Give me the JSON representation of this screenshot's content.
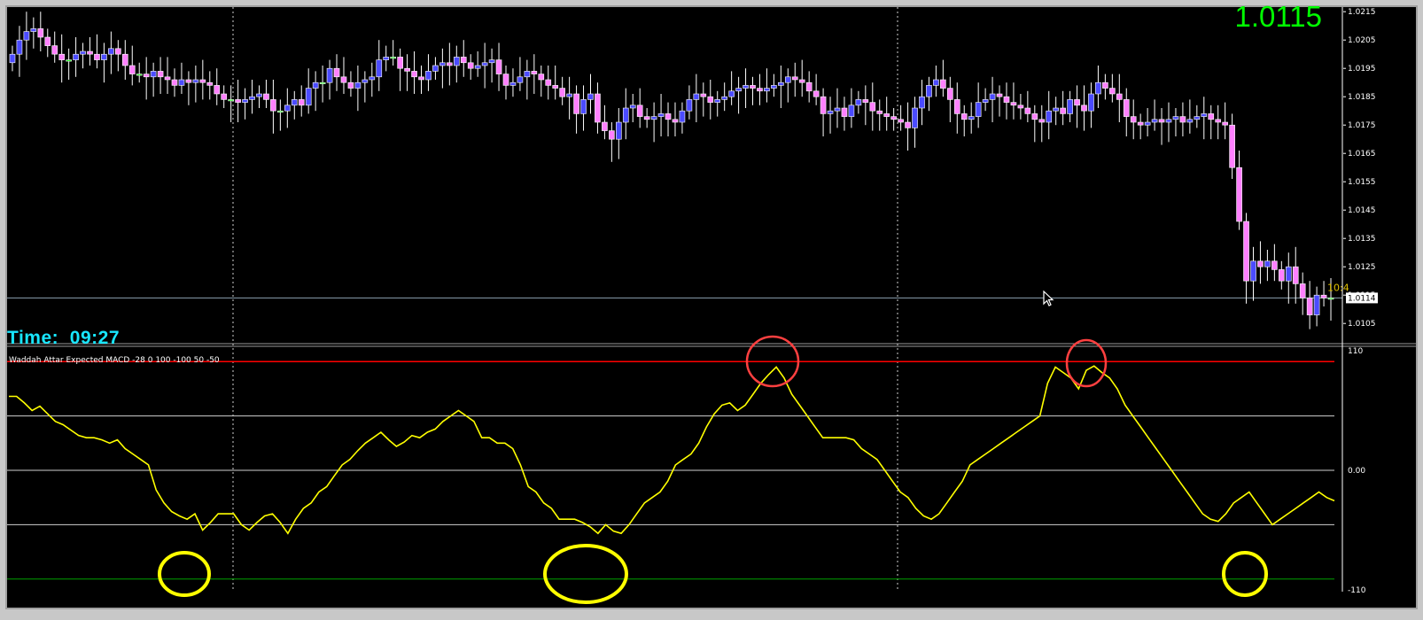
{
  "window": {
    "current_price_big": "1.0115",
    "time_label": "Time:  09:27",
    "cursor_icon": "arrow-cursor-icon",
    "clipped_time_text": "10:4"
  },
  "price_axis": {
    "labels": [
      "1.0215",
      "1.0205",
      "1.0195",
      "1.0185",
      "1.0175",
      "1.0165",
      "1.0155",
      "1.0145",
      "1.0135",
      "1.0125",
      "1.0115",
      "1.0105"
    ],
    "current_label": "1.0114",
    "range": [
      1.0101,
      1.0216
    ]
  },
  "indicator": {
    "title": "Waddah Attar Expected MACD -28 0 100 -100 50 -50",
    "axis_labels": [
      "110",
      "0.00",
      "-110"
    ]
  },
  "colors": {
    "background": "#000000",
    "bull_body": "#4b4bff",
    "bear_body": "#ff80ff",
    "doji": "#00ff00",
    "line": "#ffff00",
    "upper_level": "#ff0000",
    "lower_level": "#00a000",
    "time_text": "#18e6ff",
    "big_price_text": "#00ff00",
    "circle_low": "#ffff00",
    "circle_high": "#ff4040"
  },
  "chart_data": [
    {
      "type": "candlestick",
      "title": "",
      "ylim": [
        1.0101,
        1.0216
      ],
      "close": [
        1.02,
        1.0205,
        1.0208,
        1.0209,
        1.0206,
        1.0203,
        1.02,
        1.0198,
        1.0198,
        1.02,
        1.0201,
        1.02,
        1.0198,
        1.02,
        1.0202,
        1.02,
        1.0196,
        1.0193,
        1.0193,
        1.0192,
        1.0194,
        1.0192,
        1.0191,
        1.0189,
        1.0191,
        1.019,
        1.0191,
        1.019,
        1.0189,
        1.0186,
        1.0184,
        1.0184,
        1.0183,
        1.0184,
        1.0185,
        1.0186,
        1.0184,
        1.018,
        1.018,
        1.0182,
        1.0184,
        1.0182,
        1.0188,
        1.019,
        1.019,
        1.0195,
        1.0192,
        1.019,
        1.0188,
        1.019,
        1.0191,
        1.0192,
        1.0198,
        1.0199,
        1.0199,
        1.0195,
        1.0194,
        1.0192,
        1.0191,
        1.0194,
        1.0196,
        1.0197,
        1.0196,
        1.0199,
        1.0197,
        1.0195,
        1.0196,
        1.0197,
        1.0198,
        1.0193,
        1.0189,
        1.019,
        1.0192,
        1.0194,
        1.0193,
        1.0191,
        1.0189,
        1.0188,
        1.0185,
        1.0186,
        1.0179,
        1.0184,
        1.0186,
        1.0176,
        1.0173,
        1.017,
        1.0176,
        1.0181,
        1.0182,
        1.0178,
        1.0177,
        1.0178,
        1.0179,
        1.0177,
        1.0176,
        1.018,
        1.0184,
        1.0186,
        1.0185,
        1.0183,
        1.0184,
        1.0185,
        1.0187,
        1.0188,
        1.0189,
        1.0188,
        1.0187,
        1.0188,
        1.0189,
        1.019,
        1.0192,
        1.0191,
        1.019,
        1.0187,
        1.0185,
        1.0179,
        1.018,
        1.0181,
        1.0178,
        1.0182,
        1.0184,
        1.0183,
        1.018,
        1.0179,
        1.0178,
        1.0177,
        1.0176,
        1.0174,
        1.0181,
        1.0185,
        1.0189,
        1.0191,
        1.0188,
        1.0184,
        1.0179,
        1.0177,
        1.0178,
        1.0183,
        1.0184,
        1.0186,
        1.0185,
        1.0183,
        1.0182,
        1.0181,
        1.0179,
        1.0177,
        1.0176,
        1.018,
        1.0181,
        1.0179,
        1.0184,
        1.0182,
        1.018,
        1.0186,
        1.019,
        1.0188,
        1.0186,
        1.0184,
        1.0178,
        1.0176,
        1.0175,
        1.0176,
        1.0177,
        1.0176,
        1.0177,
        1.0178,
        1.0176,
        1.0177,
        1.0178,
        1.0179,
        1.0177,
        1.0176,
        1.0175,
        1.016,
        1.0141,
        1.012,
        1.0127,
        1.0125,
        1.0127,
        1.0124,
        1.012,
        1.0125,
        1.0119,
        1.0114,
        1.0108,
        1.0115,
        1.0114,
        1.0114
      ],
      "current_price": 1.0114
    },
    {
      "type": "line",
      "title": "Waddah Attar Expected MACD -28 0 100 -100 50 -50",
      "ylim": [
        -110,
        110
      ],
      "levels": [
        100,
        50,
        0,
        -50,
        -100
      ],
      "series": [
        {
          "values": [
            68,
            68,
            62,
            55,
            59,
            52,
            45,
            42,
            37,
            32,
            30,
            30,
            28,
            25,
            28,
            20,
            15,
            10,
            5,
            -18,
            -30,
            -38,
            -42,
            -45,
            -40,
            -55,
            -48,
            -40,
            -40,
            -40,
            -50,
            -55,
            -48,
            -42,
            -40,
            -48,
            -58,
            -45,
            -35,
            -30,
            -20,
            -15,
            -5,
            5,
            10,
            18,
            25,
            30,
            35,
            28,
            22,
            26,
            32,
            30,
            35,
            38,
            45,
            50,
            55,
            50,
            45,
            30,
            30,
            25,
            25,
            20,
            5,
            -15,
            -20,
            -30,
            -35,
            -45,
            -45,
            -45,
            -48,
            -52,
            -58,
            -50,
            -56,
            -58,
            -50,
            -40,
            -30,
            -25,
            -20,
            -10,
            5,
            10,
            15,
            25,
            40,
            52,
            60,
            62,
            55,
            60,
            70,
            80,
            88,
            95,
            85,
            70,
            60,
            50,
            40,
            30,
            30,
            30,
            30,
            28,
            20,
            15,
            10,
            0,
            -10,
            -20,
            -25,
            -35,
            -42,
            -45,
            -40,
            -30,
            -20,
            -10,
            5,
            10,
            15,
            20,
            25,
            30,
            35,
            40,
            45,
            50,
            80,
            95,
            90,
            85,
            75,
            92,
            96,
            90,
            85,
            75,
            60,
            50,
            40,
            30,
            20,
            10,
            0,
            -10,
            -20,
            -30,
            -40,
            -45,
            -47,
            -40,
            -30,
            -25,
            -20,
            -30,
            -40,
            -50,
            -45,
            -40,
            -35,
            -30,
            -25,
            -20,
            -25,
            -28
          ]
        }
      ]
    }
  ]
}
